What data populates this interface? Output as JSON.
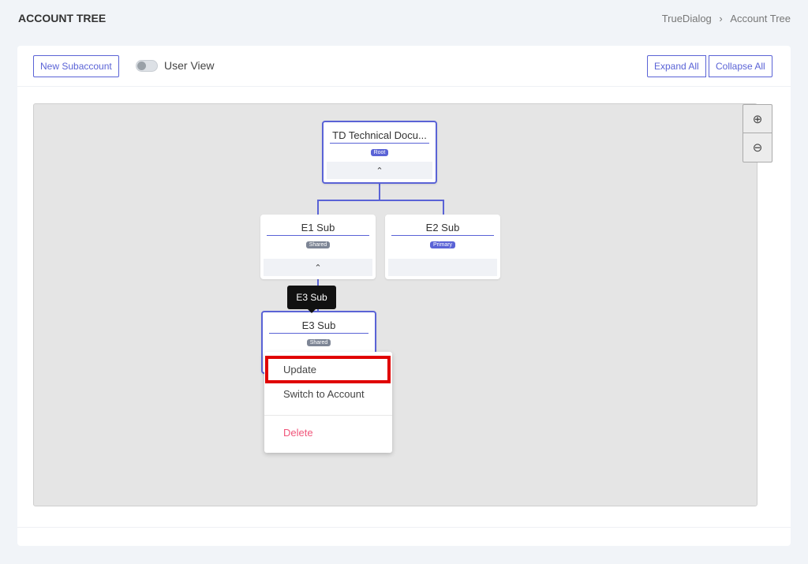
{
  "header": {
    "title": "ACCOUNT TREE",
    "breadcrumb": [
      "TrueDialog",
      "Account Tree"
    ],
    "separator": "›"
  },
  "toolbar": {
    "new_subaccount": "New Subaccount",
    "user_view": "User View",
    "user_view_on": false,
    "expand_all": "Expand All",
    "collapse_all": "Collapse All"
  },
  "zoom": {
    "in": "+",
    "out": "−"
  },
  "tree": {
    "root": {
      "name": "TD Technical Docu...",
      "badge": "Root",
      "badge_color": "#5a63d6",
      "collapse": "⌃"
    },
    "e1": {
      "name": "E1 Sub",
      "badge": "Shared",
      "badge_color": "#7d8595",
      "collapse": "⌃"
    },
    "e2": {
      "name": "E2 Sub",
      "badge": "Primary",
      "badge_color": "#5a63d6"
    },
    "e3": {
      "name": "E3 Sub",
      "badge": "Shared",
      "badge_color": "#7d8595"
    }
  },
  "tooltip": "E3 Sub",
  "context_menu": {
    "items": [
      "Update",
      "Switch to Account",
      "Delete"
    ],
    "highlighted": "Update",
    "delete_color": "#f0557a",
    "highlight_color": "#e00000"
  }
}
